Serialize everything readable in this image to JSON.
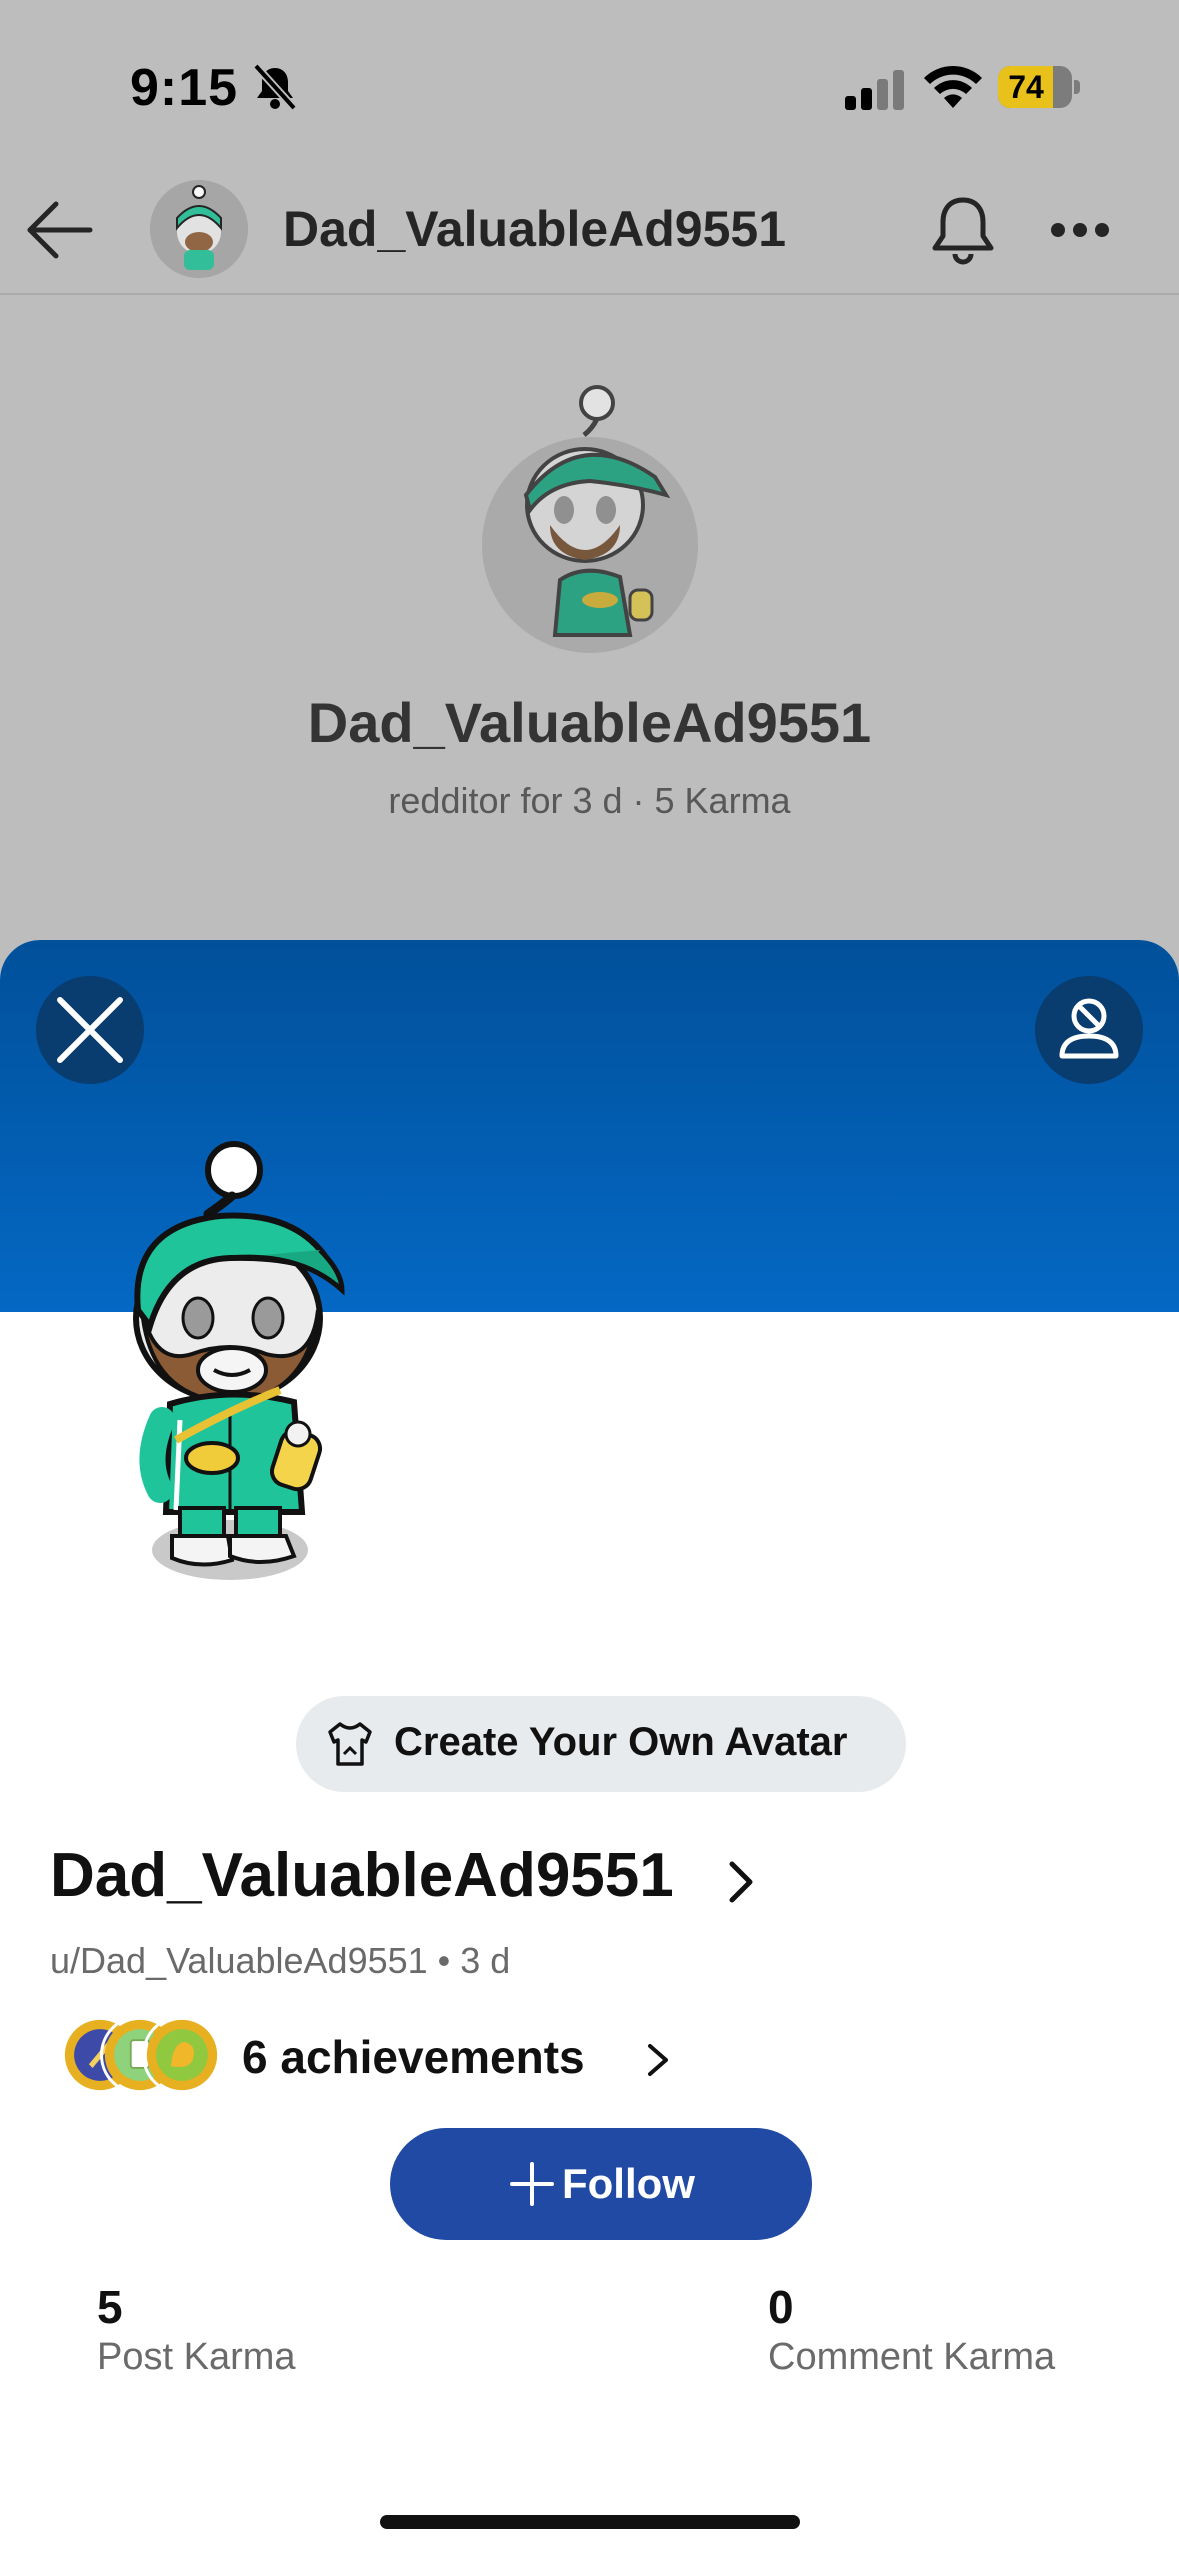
{
  "status_bar": {
    "time": "9:15",
    "battery_percent": "74",
    "battery_level": 0.74
  },
  "topbar": {
    "username": "Dad_ValuableAd9551"
  },
  "profile_header": {
    "name": "Dad_ValuableAd9551",
    "meta": "redditor for 3 d · 5 Karma"
  },
  "sheet": {
    "create_avatar_label": "Create Your Own Avatar",
    "name": "Dad_ValuableAd9551",
    "subline": "u/Dad_ValuableAd9551 • 3 d",
    "achievements_label": "6 achievements",
    "follow_label": "Follow",
    "stats": [
      {
        "value": "5",
        "label": "Post Karma"
      },
      {
        "value": "0",
        "label": "Comment Karma"
      }
    ]
  },
  "icons": {
    "back": "arrow-left-icon",
    "notifications": "bell-icon",
    "more": "ellipsis-icon",
    "close": "close-icon",
    "block": "user-block-icon",
    "muted": "bell-slash-icon",
    "create_avatar": "tshirt-icon"
  },
  "colors": {
    "banner_top": "#01509a",
    "banner_bottom": "#0468c4",
    "follow_button": "#214aa5",
    "avatar_green": "#1fbf93",
    "battery": "#e8c21b"
  }
}
